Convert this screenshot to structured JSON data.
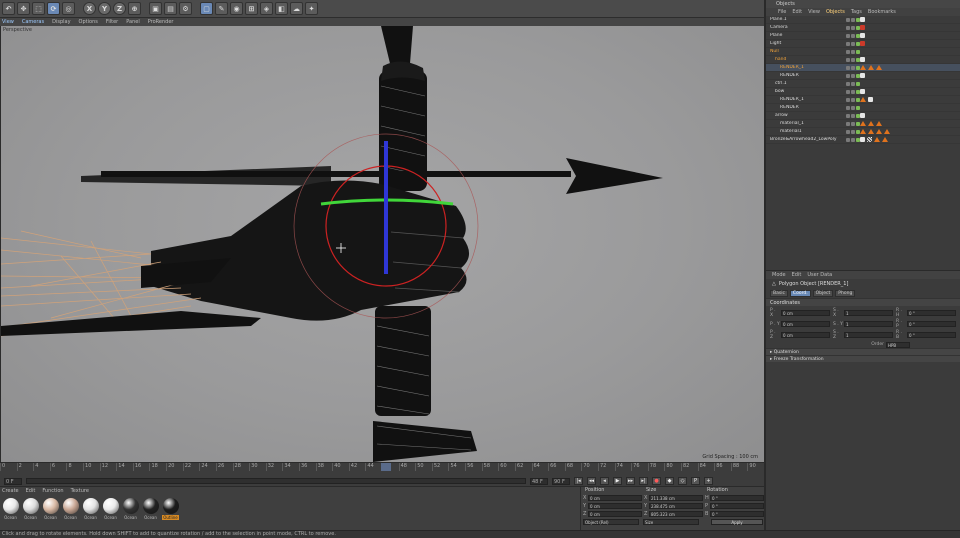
{
  "toolbar": {
    "buttons": [
      "undo",
      "move",
      "scale",
      "rotate",
      "live-select",
      "X",
      "Y",
      "Z",
      "world-coords",
      "render-view",
      "render-picture",
      "render-settings",
      "cube",
      "pen",
      "subdivision",
      "array",
      "deformer",
      "camera",
      "scene",
      "light"
    ]
  },
  "viewport_menu": {
    "items": [
      "View",
      "Cameras",
      "Display",
      "Options",
      "Filter",
      "Panel",
      "ProRender"
    ]
  },
  "viewport": {
    "label": "Perspective",
    "grid_spacing": "Grid Spacing : 100 cm"
  },
  "timeline": {
    "ticks": [
      "0",
      "2",
      "4",
      "6",
      "8",
      "10",
      "12",
      "14",
      "16",
      "18",
      "20",
      "22",
      "24",
      "26",
      "28",
      "30",
      "32",
      "34",
      "36",
      "38",
      "40",
      "42",
      "44",
      "46",
      "48",
      "50",
      "52",
      "54",
      "56",
      "58",
      "60",
      "62",
      "64",
      "66",
      "68",
      "70",
      "72",
      "74",
      "76",
      "78",
      "80",
      "82",
      "84",
      "86",
      "88",
      "90"
    ],
    "current_frame": "48 F"
  },
  "transport": {
    "start": "0 F",
    "end": "90 F",
    "buttons": [
      "|◂",
      "◂◂",
      "◂",
      "▶",
      "▸▸",
      "▸|",
      "●",
      "◆",
      "◇",
      "P",
      "+"
    ]
  },
  "materials": {
    "menu": [
      "Create",
      "Edit",
      "Function",
      "Texture"
    ],
    "items": [
      {
        "name": "Ocean",
        "color": "#e8e8e8"
      },
      {
        "name": "Ocean",
        "color": "#dcdcdc"
      },
      {
        "name": "Ocean",
        "color": "#d9b9a4"
      },
      {
        "name": "Ocean",
        "color": "#c9a794"
      },
      {
        "name": "Ocean",
        "color": "#e2e2e2"
      },
      {
        "name": "Ocean",
        "color": "#eaeaea"
      },
      {
        "name": "Ocean",
        "color": "#333333"
      },
      {
        "name": "Ocean",
        "color": "#222222"
      },
      {
        "name": "Outline",
        "color": "#1c1c1c"
      }
    ]
  },
  "coordinates": {
    "headers": [
      "Position",
      "Size",
      "Rotation"
    ],
    "rows": [
      {
        "axis1": "X",
        "pos": "0 cm",
        "axis2": "X",
        "size": "211.338 cm",
        "axis3": "H",
        "rot": "0 °"
      },
      {
        "axis1": "Y",
        "pos": "0 cm",
        "axis2": "Y",
        "size": "238.475 cm",
        "axis3": "P",
        "rot": "0 °"
      },
      {
        "axis1": "Z",
        "pos": "0 cm",
        "axis2": "Z",
        "size": "805.323 cm",
        "axis3": "B",
        "rot": "0 °"
      }
    ],
    "mode": "Object (Rel)",
    "size_mode": "Size",
    "apply": "Apply"
  },
  "objects_panel": {
    "title": "Objects",
    "menu": [
      "File",
      "Edit",
      "View",
      "Objects",
      "Tags",
      "Bookmarks"
    ],
    "rows": [
      {
        "name": "Plane.1",
        "orange": false,
        "tags": [
          "phong"
        ]
      },
      {
        "name": "Camera",
        "orange": false,
        "tags": [
          "red"
        ]
      },
      {
        "name": "Plane",
        "orange": false,
        "tags": [
          "phong"
        ]
      },
      {
        "name": "Light",
        "orange": false,
        "tags": [
          "red"
        ]
      },
      {
        "name": "Null",
        "orange": true,
        "tags": []
      },
      {
        "name": "hand",
        "orange": true,
        "tags": [
          "phong"
        ]
      },
      {
        "name": "RENDER_1",
        "orange": true,
        "tags": [
          "tri",
          "tri",
          "tri"
        ]
      },
      {
        "name": "RENDER",
        "orange": false,
        "tags": [
          "phong"
        ]
      },
      {
        "name": "ctrl.1",
        "orange": false,
        "tags": []
      },
      {
        "name": "bow",
        "orange": false,
        "tags": [
          "phong"
        ]
      },
      {
        "name": "RENDER_1",
        "orange": false,
        "tags": [
          "tri",
          "phong"
        ]
      },
      {
        "name": "RENDER",
        "orange": false,
        "tags": []
      },
      {
        "name": "arrow",
        "orange": false,
        "tags": [
          "phong"
        ]
      },
      {
        "name": "material_1",
        "orange": false,
        "tags": [
          "tri",
          "tri",
          "tri"
        ]
      },
      {
        "name": "material1",
        "orange": false,
        "tags": [
          "tri",
          "tri",
          "tri",
          "tri"
        ]
      },
      {
        "name": "Bronze&Arrowhead2_LowPoly",
        "orange": false,
        "tags": [
          "phong",
          "check",
          "tri",
          "tri"
        ]
      }
    ]
  },
  "attributes": {
    "menu": [
      "Mode",
      "Edit",
      "User Data"
    ],
    "object_name": "Polygon Object [RENDER_1]",
    "tabs": [
      "Basic",
      "Coord.",
      "Object",
      "Phong"
    ],
    "section": "Coordinates",
    "grid": [
      {
        "l": "P . X",
        "v": "0 cm"
      },
      {
        "l": "S . X",
        "v": "1"
      },
      {
        "l": "R . H",
        "v": "0 °"
      },
      {
        "l": "P . Y",
        "v": "0 cm"
      },
      {
        "l": "S . Y",
        "v": "1"
      },
      {
        "l": "R . P",
        "v": "0 °"
      },
      {
        "l": "P . Z",
        "v": "0 cm"
      },
      {
        "l": "S . Z",
        "v": "1"
      },
      {
        "l": "R . B",
        "v": "0 °"
      }
    ],
    "order_label": "Order",
    "order_value": "HPB",
    "folds": [
      "Quaternion",
      "Freeze Transformation"
    ]
  },
  "status": "Click and drag to rotate elements. Hold down SHIFT to add to quantize rotation / add to the selection in point mode, CTRL to remove."
}
